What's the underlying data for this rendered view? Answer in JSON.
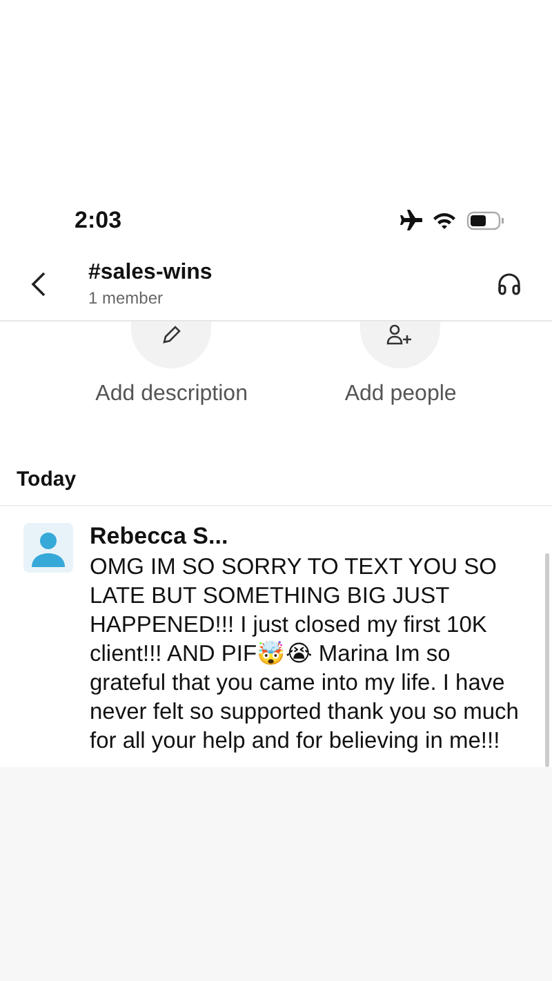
{
  "status_bar": {
    "time": "2:03"
  },
  "header": {
    "title": "#sales-wins",
    "subtitle": "1 member"
  },
  "actions": [
    {
      "kind": "description",
      "label": "Add description"
    },
    {
      "kind": "people",
      "label": "Add people"
    }
  ],
  "section": "Today",
  "message": {
    "author": "Rebecca S...",
    "text": "OMG IM SO SORRY TO TEXT YOU SO LATE BUT SOMETHING BIG JUST HAPPENED!!! I just closed my first 10K client!!! AND PIF🤯😭 Marina Im so grateful that you came into my life. I have never felt so supported thank you so much for all your help and for believing in me!!!"
  }
}
